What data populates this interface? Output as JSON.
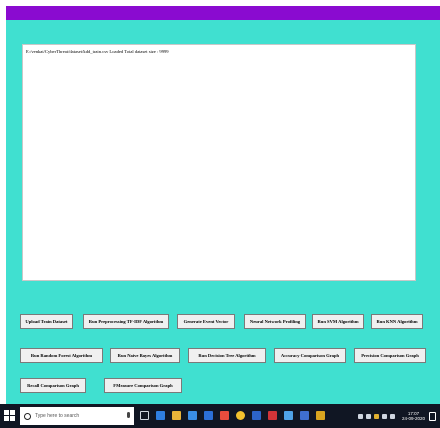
{
  "output": {
    "text": "E:/venkat/CyberThreat/dataset/kdd_train.csv Loaded Total dataset size : 9999"
  },
  "buttons": {
    "upload": "Upload Train Dataset",
    "preprocess": "Run Preprocessing TF-IDF Algorithm",
    "event_vector": "Generate Event Vector",
    "nn_profiling": "Neural Network Profiling",
    "svm": "Run SVM Algorithm",
    "knn": "Run KNN Algorithm",
    "random_forest": "Run Random Forest Algorithm",
    "naive_bayes": "Run Naive Bayes Algorithm",
    "decision_tree": "Run Decision Tree Algorithm",
    "accuracy_graph": "Accuracy Comparison Graph",
    "precision_graph": "Precision Comparison Graph",
    "recall_graph": "Recall Comparison Graph",
    "fmeasure_graph": "FMeasure Comparison Graph"
  },
  "taskbar": {
    "search_placeholder": "Type here to search",
    "time": "17:07",
    "date": "24-09-2020"
  },
  "colors": {
    "titlebar": "#8a0bd0",
    "background": "#40e0d0",
    "taskbar": "#101623"
  }
}
